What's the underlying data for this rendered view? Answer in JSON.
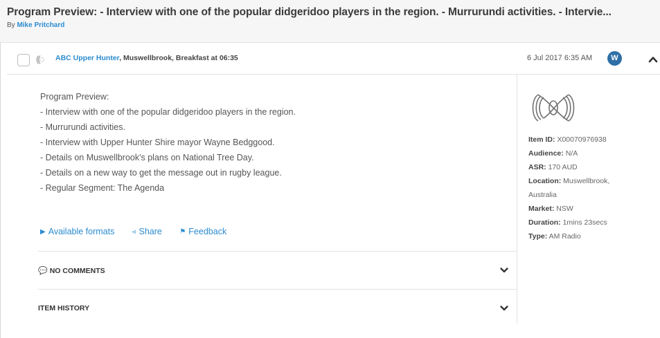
{
  "header": {
    "title": "Program Preview: - Interview with one of the popular didgeridoo players in the region. - Murrurundi activities. - Intervie...",
    "by_label": "By",
    "author": "Mike Pritchard"
  },
  "item": {
    "station": "ABC Upper Hunter",
    "location_program": ", Muswellbrook, Breakfast at 06:35",
    "timestamp": "6 Jul 2017 6:35 AM",
    "avatar_letter": "W"
  },
  "summary": {
    "lines": [
      "Program Preview:",
      "- Interview with one of the popular didgeridoo players in the region.",
      "- Murrurundi activities.",
      "- Interview with Upper Hunter Shire mayor Wayne Bedggood.",
      "- Details on Muswellbrook's plans on National Tree Day.",
      "- Details on a new way to get the message out in rugby league.",
      "- Regular Segment: The Agenda"
    ]
  },
  "actions": {
    "available_formats": "Available formats",
    "share": "Share",
    "feedback": "Feedback"
  },
  "sections": {
    "comments": "NO COMMENTS",
    "history": "ITEM HISTORY"
  },
  "meta": {
    "item_id_key": "Item ID:",
    "item_id": "X00070976938",
    "audience_key": "Audience:",
    "audience": "N/A",
    "asr_key": "ASR:",
    "asr": "170 AUD",
    "location_key": "Location:",
    "location": "Muswellbrook,",
    "location_2": "Australia",
    "market_key": "Market:",
    "market": "NSW",
    "duration_key": "Duration:",
    "duration": "1mins 23secs",
    "type_key": "Type:",
    "type": "AM Radio"
  },
  "icons": {
    "radio": "radio-broadcast-icon",
    "play": "play-icon",
    "share": "share-icon",
    "feedback": "flag-icon",
    "comments": "speech-bubbles-icon",
    "chevron_up": "chevron-up-icon",
    "chevron_down": "chevron-down-icon",
    "logo": "abc-logo"
  },
  "colors": {
    "accent": "#2a8bd0",
    "avatar": "#2e6fa7"
  }
}
